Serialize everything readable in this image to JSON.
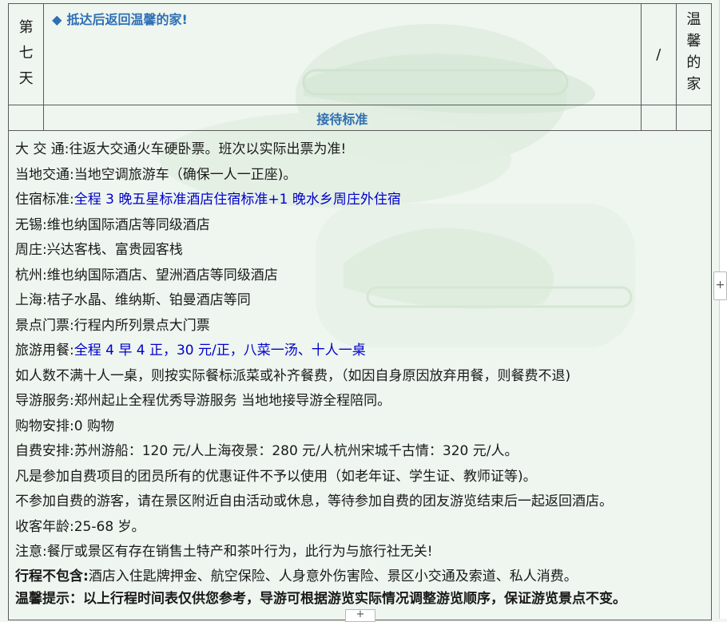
{
  "day_row": {
    "day_chars": [
      "第",
      "七",
      "天"
    ],
    "description": "抵达后返回温馨的家!",
    "meal": "/",
    "hotel_chars": [
      "温",
      "馨",
      "的",
      "家"
    ]
  },
  "standard_header": "接待标准",
  "standards": [
    {
      "label": "大 交 通:",
      "text": "往返大交通火车硬卧票。班次以实际出票为准!",
      "blue": false
    },
    {
      "label": "当地交通:",
      "text": "当地空调旅游车（确保一人一正座)。",
      "blue": false
    },
    {
      "label": "住宿标准:",
      "text": "全程 3 晚五星标准酒店住宿标准+1 晚水乡周庄外住宿",
      "blue": true
    },
    {
      "label": "无锡:",
      "text": "维也纳国际酒店等同级酒店",
      "blue": false
    },
    {
      "label": "周庄:",
      "text": "兴达客栈、富贵园客栈",
      "blue": false
    },
    {
      "label": "杭州:",
      "text": "维也纳国际酒店、望洲酒店等同级酒店",
      "blue": false
    },
    {
      "label": "上海:",
      "text": "桔子水晶、维纳斯、铂曼酒店等同",
      "blue": false
    },
    {
      "label": "景点门票:",
      "text": "行程内所列景点大门票",
      "blue": false
    },
    {
      "label": "旅游用餐:",
      "text": "全程 4 早 4 正，30 元/正，八菜一汤、十人一桌",
      "blue": true
    },
    {
      "label": "",
      "text": "如人数不满十人一桌，则按实际餐标派菜或补齐餐费，（如因自身原因放弃用餐，则餐费不退)",
      "blue": false
    },
    {
      "label": "导游服务:",
      "text": "郑州起止全程优秀导游服务 当地地接导游全程陪同。",
      "blue": false
    },
    {
      "label": "购物安排:",
      "text": "0 购物",
      "blue": false
    },
    {
      "label": "自费安排:",
      "text": "苏州游船：120 元/人上海夜景：280 元/人杭州宋城千古情：320 元/人。",
      "blue": false
    },
    {
      "label": "",
      "text": "凡是参加自费项目的团员所有的优惠证件不予以使用（如老年证、学生证、教师证等)。",
      "blue": false
    },
    {
      "label": "",
      "text": "不参加自费的游客，请在景区附近自由活动或休息，等待参加自费的团友游览结束后一起返回酒店。",
      "blue": false
    },
    {
      "label": "收客年龄:",
      "text": "25-68 岁。",
      "blue": false
    },
    {
      "label": "注意:",
      "text": "餐厅或景区有存在销售土特产和茶叶行为，此行为与旅行社无关!",
      "blue": false
    }
  ],
  "exclusions": {
    "label": "行程不包含:",
    "text": "酒店入住匙牌押金、航空保险、人身意外伤害险、景区小交通及索道、私人消费。"
  },
  "tips": "温馨提示：以上行程时间表仅供您参考，导游可根据游览实际情况调整游览顺序，保证游览景点不变。",
  "ui": {
    "side_handle": "+",
    "bottom_handle": "+"
  }
}
